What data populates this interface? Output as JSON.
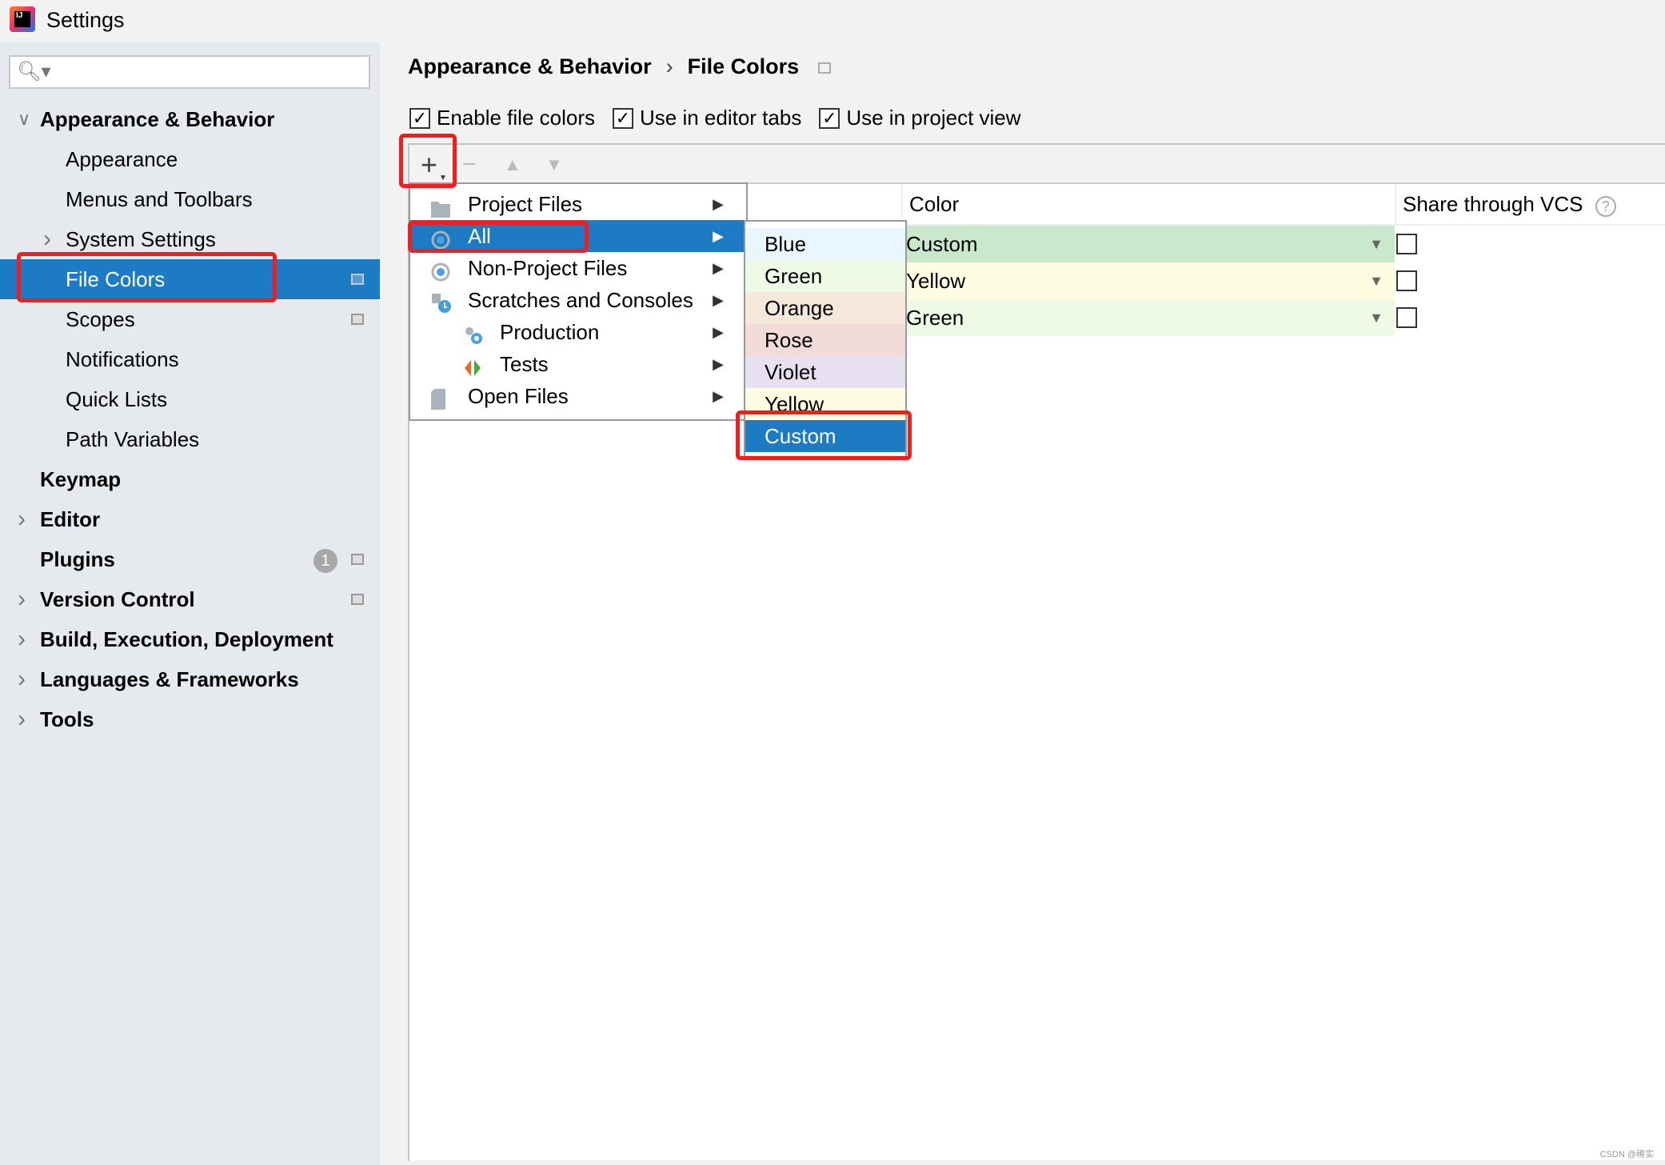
{
  "window": {
    "title": "Settings",
    "logo_text": "IJ"
  },
  "search": {
    "icon": "search-icon",
    "value": ""
  },
  "sidebar": {
    "items": [
      {
        "label": "Appearance & Behavior",
        "level": 0,
        "bold": true,
        "expanded": true
      },
      {
        "label": "Appearance",
        "level": 1
      },
      {
        "label": "Menus and Toolbars",
        "level": 1
      },
      {
        "label": "System Settings",
        "level": 1,
        "collapsed": true
      },
      {
        "label": "File Colors",
        "level": 1,
        "selected": true,
        "project_icon": true
      },
      {
        "label": "Scopes",
        "level": 1,
        "project_icon": true
      },
      {
        "label": "Notifications",
        "level": 1
      },
      {
        "label": "Quick Lists",
        "level": 1
      },
      {
        "label": "Path Variables",
        "level": 1
      },
      {
        "label": "Keymap",
        "level": 0,
        "bold": true
      },
      {
        "label": "Editor",
        "level": 0,
        "bold": true,
        "collapsed": true
      },
      {
        "label": "Plugins",
        "level": 0,
        "bold": true,
        "badge": "1",
        "project_icon": true
      },
      {
        "label": "Version Control",
        "level": 0,
        "bold": true,
        "collapsed": true,
        "project_icon": true
      },
      {
        "label": "Build, Execution, Deployment",
        "level": 0,
        "bold": true,
        "collapsed": true
      },
      {
        "label": "Languages & Frameworks",
        "level": 0,
        "bold": true,
        "collapsed": true
      },
      {
        "label": "Tools",
        "level": 0,
        "bold": true,
        "collapsed": true
      }
    ]
  },
  "breadcrumb": {
    "parent": "Appearance & Behavior",
    "separator": "›",
    "current": "File Colors"
  },
  "options": [
    {
      "label": "Enable file colors",
      "checked": true
    },
    {
      "label": "Use in editor tabs",
      "checked": true
    },
    {
      "label": "Use in project view",
      "checked": true
    }
  ],
  "toolbar": {
    "add": "+",
    "remove": "−",
    "up": "▲",
    "down": "▼"
  },
  "table": {
    "headers": [
      "",
      "Color",
      "Share through VCS"
    ],
    "help_icon": "?",
    "rows": [
      {
        "color": "Custom",
        "bg": "#c9e8cc",
        "shared": false
      },
      {
        "color": "Yellow",
        "bg": "#fefde2",
        "shared": false
      },
      {
        "color": "Green",
        "bg": "#eefae6",
        "shared": false
      }
    ]
  },
  "scope_menu": {
    "items": [
      {
        "label": "Project Files",
        "icon": "folder-icon"
      },
      {
        "label": "All",
        "icon": "scope-icon",
        "selected": true
      },
      {
        "label": "Non-Project Files",
        "icon": "scope-icon"
      },
      {
        "label": "Scratches and Consoles",
        "icon": "scratches-icon"
      },
      {
        "label": "Production",
        "icon": "production-icon",
        "indent": true
      },
      {
        "label": "Tests",
        "icon": "tests-icon",
        "indent": true
      },
      {
        "label": "Open Files",
        "icon": "file-icon"
      }
    ]
  },
  "color_menu": {
    "items": [
      {
        "label": "Blue",
        "bg": "#eaf6ff"
      },
      {
        "label": "Green",
        "bg": "#eefae6"
      },
      {
        "label": "Orange",
        "bg": "#f6e9dc"
      },
      {
        "label": "Rose",
        "bg": "#f2dcda"
      },
      {
        "label": "Violet",
        "bg": "#e6e0f1"
      },
      {
        "label": "Yellow",
        "bg": "#fefde2"
      },
      {
        "label": "Custom",
        "selected": true
      }
    ]
  },
  "colors": {
    "accent": "#1d7bc4",
    "highlight": "#f21d1d"
  },
  "watermark": "CSDN @稀实"
}
